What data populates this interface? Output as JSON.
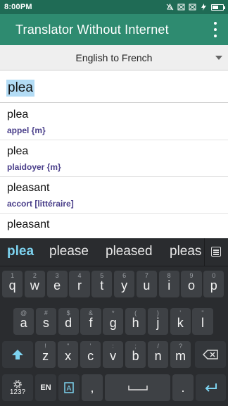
{
  "status_bar": {
    "time": "8:00PM",
    "battery": "43"
  },
  "app_bar": {
    "title": "Translator Without Internet"
  },
  "language_spinner": {
    "selected": "English to French"
  },
  "search": {
    "value": "plea"
  },
  "results": [
    {
      "word": "plea",
      "translation": "appel {m}"
    },
    {
      "word": "plea",
      "translation": "plaidoyer {m}"
    },
    {
      "word": "pleasant",
      "translation": "accort [littéraire]"
    },
    {
      "word": "pleasant",
      "translation": ""
    }
  ],
  "keyboard": {
    "suggestions": [
      "plea",
      "please",
      "pleased",
      "pleas"
    ],
    "row1": [
      {
        "k": "q",
        "h": "1"
      },
      {
        "k": "w",
        "h": "2"
      },
      {
        "k": "e",
        "h": "3"
      },
      {
        "k": "r",
        "h": "4"
      },
      {
        "k": "t",
        "h": "5"
      },
      {
        "k": "y",
        "h": "6"
      },
      {
        "k": "u",
        "h": "7"
      },
      {
        "k": "i",
        "h": "8"
      },
      {
        "k": "o",
        "h": "9"
      },
      {
        "k": "p",
        "h": "0"
      }
    ],
    "row2": [
      {
        "k": "a",
        "h": "@"
      },
      {
        "k": "s",
        "h": "#"
      },
      {
        "k": "d",
        "h": "$"
      },
      {
        "k": "f",
        "h": "&"
      },
      {
        "k": "g",
        "h": "*"
      },
      {
        "k": "h",
        "h": "("
      },
      {
        "k": "j",
        "h": ")"
      },
      {
        "k": "k",
        "h": "'"
      },
      {
        "k": "l",
        "h": "\""
      }
    ],
    "row3": [
      {
        "k": "z",
        "h": "!"
      },
      {
        "k": "x",
        "h": "\""
      },
      {
        "k": "c",
        "h": "'"
      },
      {
        "k": "v",
        "h": ":"
      },
      {
        "k": "b",
        "h": ";"
      },
      {
        "k": "n",
        "h": "/"
      },
      {
        "k": "m",
        "h": "?"
      }
    ],
    "symbols_label": "123?",
    "language_label": "EN",
    "comma": ",",
    "period": "."
  }
}
